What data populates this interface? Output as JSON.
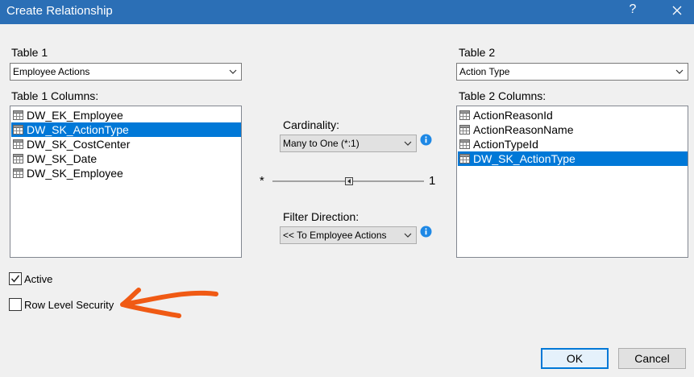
{
  "window": {
    "title": "Create Relationship",
    "help": "?"
  },
  "table1": {
    "label": "Table 1",
    "selected": "Employee Actions",
    "columns_label": "Table 1 Columns:",
    "columns": [
      "DW_EK_Employee",
      "DW_SK_ActionType",
      "DW_SK_CostCenter",
      "DW_SK_Date",
      "DW_SK_Employee"
    ],
    "selected_column": "DW_SK_ActionType"
  },
  "table2": {
    "label": "Table 2",
    "selected": "Action Type",
    "columns_label": "Table 2 Columns:",
    "columns": [
      "ActionReasonId",
      "ActionReasonName",
      "ActionTypeId",
      "DW_SK_ActionType"
    ],
    "selected_column": "DW_SK_ActionType"
  },
  "cardinality": {
    "label": "Cardinality:",
    "selected": "Many to One (*:1)",
    "left_symbol": "*",
    "right_symbol": "1"
  },
  "filter_direction": {
    "label": "Filter Direction:",
    "selected": "<< To Employee Actions"
  },
  "options": {
    "active_label": "Active",
    "active_checked": true,
    "rls_label": "Row Level Security",
    "rls_checked": false
  },
  "buttons": {
    "ok": "OK",
    "cancel": "Cancel"
  },
  "colors": {
    "titlebar": "#2b6fb6",
    "selection": "#0078d7",
    "annotation": "#f05a14",
    "info": "#1e88e5"
  }
}
